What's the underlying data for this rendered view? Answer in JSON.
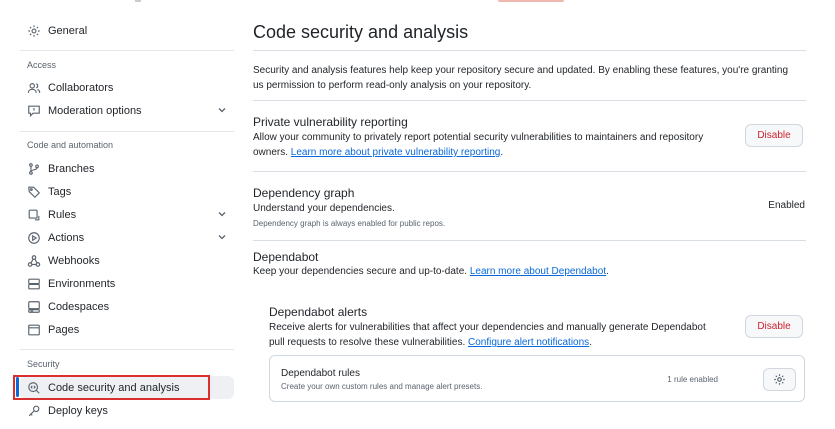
{
  "sidebar": {
    "general": "General",
    "access_heading": "Access",
    "collaborators": "Collaborators",
    "moderation": "Moderation options",
    "code_automation_heading": "Code and automation",
    "branches": "Branches",
    "tags": "Tags",
    "rules": "Rules",
    "actions": "Actions",
    "webhooks": "Webhooks",
    "environments": "Environments",
    "codespaces": "Codespaces",
    "pages": "Pages",
    "security_heading": "Security",
    "code_security": "Code security and analysis",
    "deploy_keys": "Deploy keys"
  },
  "main": {
    "title": "Code security and analysis",
    "intro": "Security and analysis features help keep your repository secure and updated. By enabling these features, you're granting us permission to perform read-only analysis on your repository.",
    "pvr": {
      "title": "Private vulnerability reporting",
      "desc": "Allow your community to privately report potential security vulnerabilities to maintainers and repository owners.",
      "link": "Learn more about private vulnerability reporting",
      "suffix": ".",
      "button": "Disable"
    },
    "depgraph": {
      "title": "Dependency graph",
      "desc": "Understand your dependencies.",
      "note": "Dependency graph is always enabled for public repos.",
      "status": "Enabled"
    },
    "dependabot": {
      "title": "Dependabot",
      "desc": "Keep your dependencies secure and up-to-date.",
      "link": "Learn more about Dependabot",
      "suffix": "."
    },
    "alerts": {
      "title": "Dependabot alerts",
      "desc": "Receive alerts for vulnerabilities that affect your dependencies and manually generate Dependabot pull requests to resolve these vulnerabilities.",
      "link": "Configure alert notifications",
      "suffix": ".",
      "button": "Disable"
    },
    "rules": {
      "title": "Dependabot rules",
      "desc": "Create your own custom rules and manage alert presets.",
      "count": "1 rule enabled"
    }
  },
  "colors": {
    "accent": "#0969da",
    "danger": "#cf222e",
    "highlight": "#d9302f"
  }
}
